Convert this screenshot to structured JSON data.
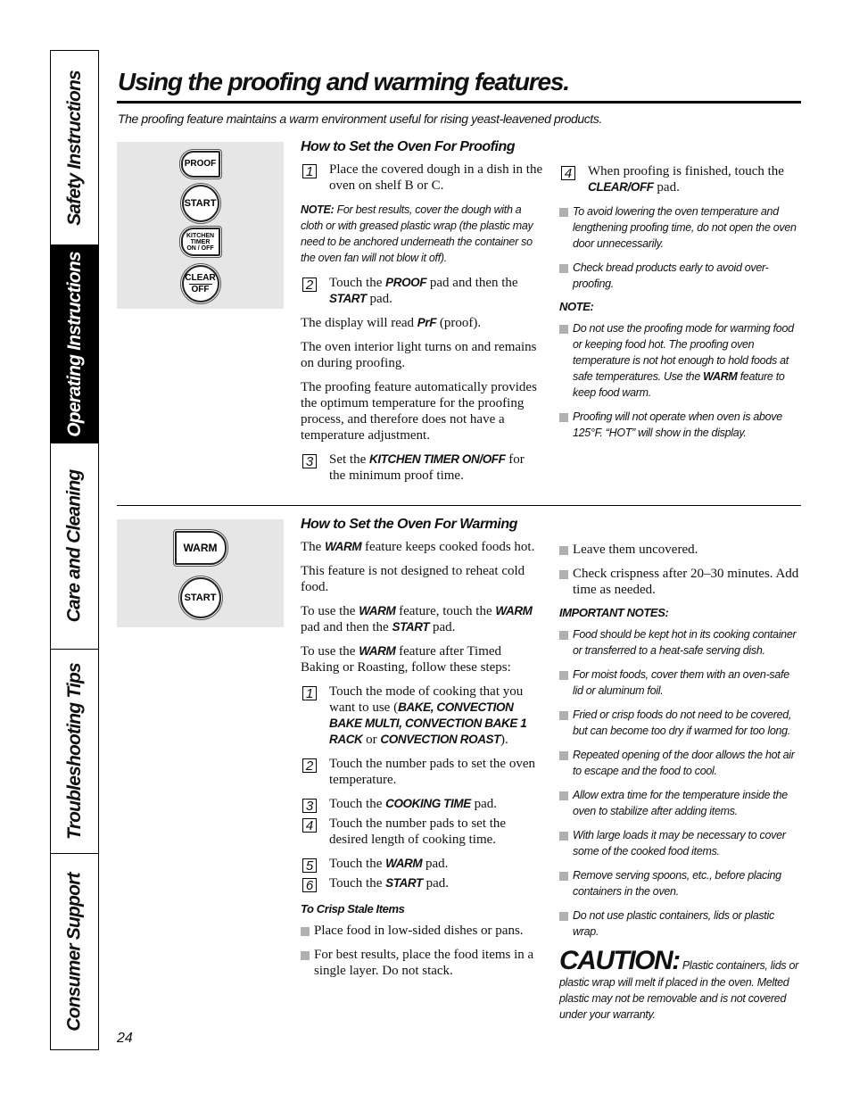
{
  "side_tabs": [
    {
      "label": "Safety Instructions",
      "active": false
    },
    {
      "label": "Operating Instructions",
      "active": true
    },
    {
      "label": "Care and Cleaning",
      "active": false
    },
    {
      "label": "Troubleshooting Tips",
      "active": false
    },
    {
      "label": "Consumer Support",
      "active": false
    }
  ],
  "header": {
    "title": "Using the proofing and warming features.",
    "subtitle": "The proofing feature maintains a warm environment useful for rising yeast-leavened products."
  },
  "proofing": {
    "pads": {
      "proof": "PROOF",
      "start": "START",
      "timer": [
        "KITCHEN",
        "TIMER",
        "ON / OFF"
      ],
      "clear": [
        "CLEAR",
        "OFF"
      ]
    },
    "heading": "How to Set the Oven For Proofing",
    "step1": {
      "num": "1",
      "text": "Place the covered dough in a dish in the oven on shelf B or C."
    },
    "note_label": "NOTE:",
    "note_text": " For best results, cover the dough with a cloth or with greased plastic wrap (the plastic may need to be anchored underneath the container so the oven fan will not blow it off).",
    "step2": {
      "num": "2",
      "pre": "Touch the ",
      "kw1": "PROOF",
      "mid": " pad and then the ",
      "kw2": "START",
      "post": " pad."
    },
    "display": {
      "pre": "The display will read ",
      "kw": "PrF",
      "post": " (proof)."
    },
    "light": "The oven interior light turns on and remains on during proofing.",
    "auto": "The proofing feature automatically provides the optimum temperature for the proofing process, and therefore does not have a temperature adjustment.",
    "step3": {
      "num": "3",
      "pre": "Set the ",
      "kw": "KITCHEN TIMER ON/OFF",
      "post": " for the minimum proof time."
    },
    "step4": {
      "num": "4",
      "pre": "When proofing is finished, touch the ",
      "kw": "CLEAR/OFF",
      "post": " pad."
    },
    "tips": [
      "To avoid lowering the oven temperature and lengthening proofing time, do not open the oven door unnecessarily.",
      "Check bread products early to avoid over-proofing."
    ],
    "note2_label": "NOTE:",
    "note2_bullet1": {
      "pre": "Do not use the proofing mode for warming food or keeping food hot. The proofing oven temperature is not hot enough to hold foods at safe temperatures. Use the ",
      "kw": "WARM",
      "post": " feature to keep food warm."
    },
    "note2_bullet2": "Proofing will not operate when oven is above 125°F. “HOT” will show in the display."
  },
  "warming": {
    "pads": {
      "warm": "WARM",
      "start": "START"
    },
    "heading": "How to Set the Oven For Warming",
    "p1": {
      "pre": "The ",
      "kw": "WARM",
      "post": " feature keeps cooked foods hot."
    },
    "p2": "This feature is not designed to reheat cold food.",
    "p3": {
      "pre": "To use the ",
      "kw1": "WARM",
      "mid": " feature, touch the ",
      "kw2": "WARM",
      "mid2": " pad and then the ",
      "kw3": "START",
      "post": " pad."
    },
    "p4": {
      "pre": "To use the ",
      "kw": "WARM",
      "post": " feature after Timed Baking or Roasting, follow these steps:"
    },
    "step1": {
      "num": "1",
      "pre": "Touch the mode of cooking that you want to use (",
      "kw1": "BAKE, CONVECTION BAKE MULTI, CONVECTION BAKE 1 RACK",
      "mid": " or ",
      "kw2": "CONVECTION ROAST",
      "post": ")."
    },
    "step2": {
      "num": "2",
      "text": "Touch the number pads to set the oven temperature."
    },
    "step3": {
      "num": "3",
      "pre": "Touch the ",
      "kw": "COOKING TIME",
      "post": " pad."
    },
    "step4": {
      "num": "4",
      "text": "Touch the number pads to set the desired length of cooking time."
    },
    "step5": {
      "num": "5",
      "pre": "Touch the ",
      "kw": "WARM",
      "post": " pad."
    },
    "step6": {
      "num": "6",
      "pre": "Touch the ",
      "kw": "START",
      "post": " pad."
    },
    "crisp_heading": "To Crisp Stale Items",
    "crisp_items": [
      "Place food in low-sided dishes or pans.",
      "For best results, place the food items in a single layer. Do not stack.",
      "Leave them uncovered.",
      "Check crispness after 20–30 minutes. Add time as needed."
    ],
    "important_heading": "IMPORTANT NOTES:",
    "important_items": [
      "Food should be kept hot in its cooking container or transferred to a heat-safe serving dish.",
      "For moist foods, cover them with an oven-safe lid or aluminum foil.",
      "Fried or crisp foods do not need to be covered, but can become too dry if warmed for too long.",
      "Repeated opening of the door allows the hot air to escape and the food to cool.",
      "Allow extra time for the temperature inside the oven to stabilize after adding items.",
      "With large loads it may be necessary to cover some of the cooked food items.",
      "Remove serving spoons, etc., before placing containers in the oven.",
      "Do not use plastic containers, lids or plastic wrap."
    ],
    "caution_label": "CAUTION:",
    "caution_text": " Plastic containers, lids or plastic wrap will melt if placed in the oven. Melted plastic may not be removable and is not covered under your warranty."
  },
  "footer": {
    "page_number": "24"
  }
}
